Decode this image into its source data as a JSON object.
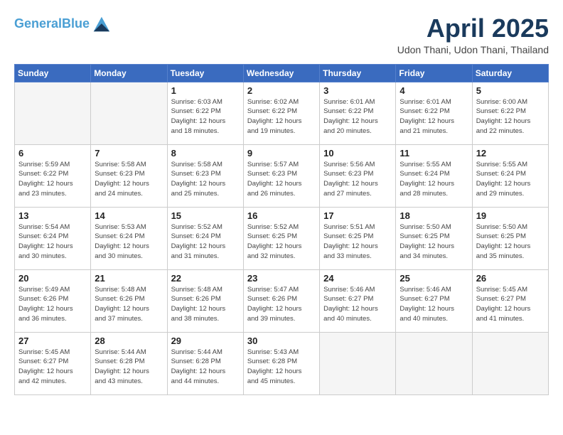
{
  "header": {
    "logo_line1": "General",
    "logo_line2": "Blue",
    "month": "April 2025",
    "location": "Udon Thani, Udon Thani, Thailand"
  },
  "days_of_week": [
    "Sunday",
    "Monday",
    "Tuesday",
    "Wednesday",
    "Thursday",
    "Friday",
    "Saturday"
  ],
  "weeks": [
    [
      {
        "num": "",
        "info": ""
      },
      {
        "num": "",
        "info": ""
      },
      {
        "num": "1",
        "info": "Sunrise: 6:03 AM\nSunset: 6:22 PM\nDaylight: 12 hours\nand 18 minutes."
      },
      {
        "num": "2",
        "info": "Sunrise: 6:02 AM\nSunset: 6:22 PM\nDaylight: 12 hours\nand 19 minutes."
      },
      {
        "num": "3",
        "info": "Sunrise: 6:01 AM\nSunset: 6:22 PM\nDaylight: 12 hours\nand 20 minutes."
      },
      {
        "num": "4",
        "info": "Sunrise: 6:01 AM\nSunset: 6:22 PM\nDaylight: 12 hours\nand 21 minutes."
      },
      {
        "num": "5",
        "info": "Sunrise: 6:00 AM\nSunset: 6:22 PM\nDaylight: 12 hours\nand 22 minutes."
      }
    ],
    [
      {
        "num": "6",
        "info": "Sunrise: 5:59 AM\nSunset: 6:22 PM\nDaylight: 12 hours\nand 23 minutes."
      },
      {
        "num": "7",
        "info": "Sunrise: 5:58 AM\nSunset: 6:23 PM\nDaylight: 12 hours\nand 24 minutes."
      },
      {
        "num": "8",
        "info": "Sunrise: 5:58 AM\nSunset: 6:23 PM\nDaylight: 12 hours\nand 25 minutes."
      },
      {
        "num": "9",
        "info": "Sunrise: 5:57 AM\nSunset: 6:23 PM\nDaylight: 12 hours\nand 26 minutes."
      },
      {
        "num": "10",
        "info": "Sunrise: 5:56 AM\nSunset: 6:23 PM\nDaylight: 12 hours\nand 27 minutes."
      },
      {
        "num": "11",
        "info": "Sunrise: 5:55 AM\nSunset: 6:24 PM\nDaylight: 12 hours\nand 28 minutes."
      },
      {
        "num": "12",
        "info": "Sunrise: 5:55 AM\nSunset: 6:24 PM\nDaylight: 12 hours\nand 29 minutes."
      }
    ],
    [
      {
        "num": "13",
        "info": "Sunrise: 5:54 AM\nSunset: 6:24 PM\nDaylight: 12 hours\nand 30 minutes."
      },
      {
        "num": "14",
        "info": "Sunrise: 5:53 AM\nSunset: 6:24 PM\nDaylight: 12 hours\nand 30 minutes."
      },
      {
        "num": "15",
        "info": "Sunrise: 5:52 AM\nSunset: 6:24 PM\nDaylight: 12 hours\nand 31 minutes."
      },
      {
        "num": "16",
        "info": "Sunrise: 5:52 AM\nSunset: 6:25 PM\nDaylight: 12 hours\nand 32 minutes."
      },
      {
        "num": "17",
        "info": "Sunrise: 5:51 AM\nSunset: 6:25 PM\nDaylight: 12 hours\nand 33 minutes."
      },
      {
        "num": "18",
        "info": "Sunrise: 5:50 AM\nSunset: 6:25 PM\nDaylight: 12 hours\nand 34 minutes."
      },
      {
        "num": "19",
        "info": "Sunrise: 5:50 AM\nSunset: 6:25 PM\nDaylight: 12 hours\nand 35 minutes."
      }
    ],
    [
      {
        "num": "20",
        "info": "Sunrise: 5:49 AM\nSunset: 6:26 PM\nDaylight: 12 hours\nand 36 minutes."
      },
      {
        "num": "21",
        "info": "Sunrise: 5:48 AM\nSunset: 6:26 PM\nDaylight: 12 hours\nand 37 minutes."
      },
      {
        "num": "22",
        "info": "Sunrise: 5:48 AM\nSunset: 6:26 PM\nDaylight: 12 hours\nand 38 minutes."
      },
      {
        "num": "23",
        "info": "Sunrise: 5:47 AM\nSunset: 6:26 PM\nDaylight: 12 hours\nand 39 minutes."
      },
      {
        "num": "24",
        "info": "Sunrise: 5:46 AM\nSunset: 6:27 PM\nDaylight: 12 hours\nand 40 minutes."
      },
      {
        "num": "25",
        "info": "Sunrise: 5:46 AM\nSunset: 6:27 PM\nDaylight: 12 hours\nand 40 minutes."
      },
      {
        "num": "26",
        "info": "Sunrise: 5:45 AM\nSunset: 6:27 PM\nDaylight: 12 hours\nand 41 minutes."
      }
    ],
    [
      {
        "num": "27",
        "info": "Sunrise: 5:45 AM\nSunset: 6:27 PM\nDaylight: 12 hours\nand 42 minutes."
      },
      {
        "num": "28",
        "info": "Sunrise: 5:44 AM\nSunset: 6:28 PM\nDaylight: 12 hours\nand 43 minutes."
      },
      {
        "num": "29",
        "info": "Sunrise: 5:44 AM\nSunset: 6:28 PM\nDaylight: 12 hours\nand 44 minutes."
      },
      {
        "num": "30",
        "info": "Sunrise: 5:43 AM\nSunset: 6:28 PM\nDaylight: 12 hours\nand 45 minutes."
      },
      {
        "num": "",
        "info": ""
      },
      {
        "num": "",
        "info": ""
      },
      {
        "num": "",
        "info": ""
      }
    ]
  ]
}
